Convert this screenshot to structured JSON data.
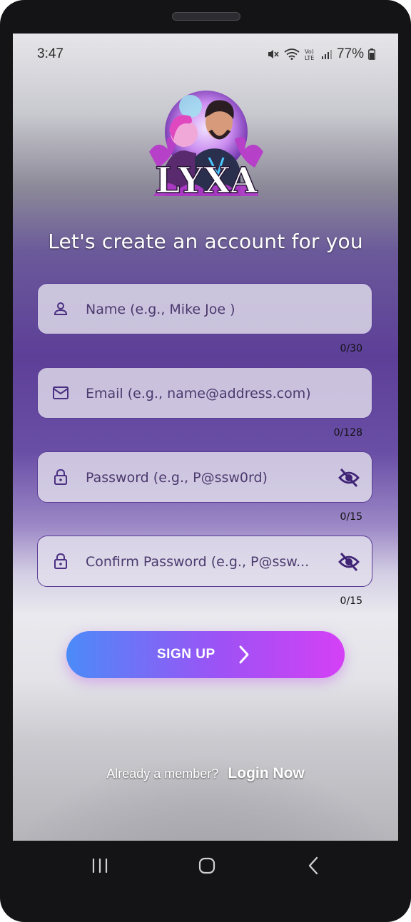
{
  "status_bar": {
    "time": "3:47",
    "battery": "77%"
  },
  "logo": {
    "text": "LYXA"
  },
  "heading": "Let's create an account for you",
  "form": {
    "name": {
      "placeholder": "Name (e.g., Mike Joe )",
      "counter": "0/30",
      "icon": "person-icon"
    },
    "email": {
      "placeholder": "Email (e.g., name@address.com)",
      "counter": "0/128",
      "icon": "mail-icon"
    },
    "password": {
      "placeholder": "Password (e.g., P@ssw0rd)",
      "counter": "0/15",
      "icon": "lock-icon"
    },
    "confirm_password": {
      "placeholder": "Confirm Password (e.g., P@ssw...",
      "counter": "0/15",
      "icon": "lock-icon"
    }
  },
  "signup_button": {
    "label": "SIGN UP"
  },
  "footer": {
    "question": "Already a member?",
    "link": "Login Now"
  },
  "colors": {
    "accent_purple": "#5a3d96",
    "button_start": "#4b8bf8",
    "button_end": "#d540f5"
  }
}
